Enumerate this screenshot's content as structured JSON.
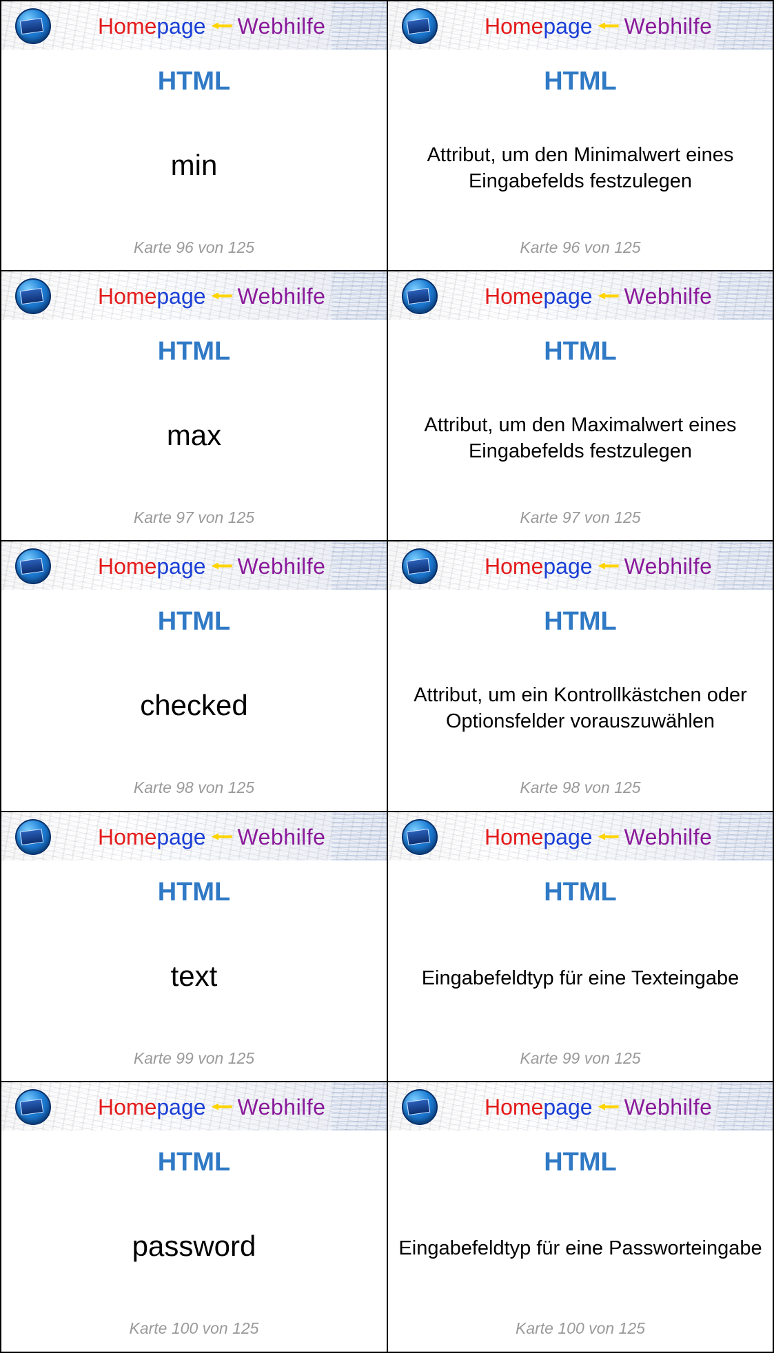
{
  "cards": [
    {
      "banner": {
        "word1": "Home",
        "word2": "page",
        "word3": "Webhilfe"
      },
      "subject": "HTML",
      "term": "min",
      "footer": "Karte 96 von 125"
    },
    {
      "banner": {
        "word1": "Home",
        "word2": "page",
        "word3": "Webhilfe"
      },
      "subject": "HTML",
      "definition": "Attribut, um den Minimalwert eines Eingabefelds festzulegen",
      "footer": "Karte 96 von 125"
    },
    {
      "banner": {
        "word1": "Home",
        "word2": "page",
        "word3": "Webhilfe"
      },
      "subject": "HTML",
      "term": "max",
      "footer": "Karte 97 von 125"
    },
    {
      "banner": {
        "word1": "Home",
        "word2": "page",
        "word3": "Webhilfe"
      },
      "subject": "HTML",
      "definition": "Attribut, um den Maximalwert eines Eingabefelds festzulegen",
      "footer": "Karte 97 von 125"
    },
    {
      "banner": {
        "word1": "Home",
        "word2": "page",
        "word3": "Webhilfe"
      },
      "subject": "HTML",
      "term": "checked",
      "footer": "Karte 98 von 125"
    },
    {
      "banner": {
        "word1": "Home",
        "word2": "page",
        "word3": "Webhilfe"
      },
      "subject": "HTML",
      "definition": "Attribut, um ein Kontrollkästchen oder Optionsfelder vorauszuwählen",
      "footer": "Karte 98 von 125"
    },
    {
      "banner": {
        "word1": "Home",
        "word2": "page",
        "word3": "Webhilfe"
      },
      "subject": "HTML",
      "term": "text",
      "footer": "Karte 99 von 125"
    },
    {
      "banner": {
        "word1": "Home",
        "word2": "page",
        "word3": "Webhilfe"
      },
      "subject": "HTML",
      "definition": "Eingabefeldtyp für eine Texteingabe",
      "footer": "Karte 99 von 125"
    },
    {
      "banner": {
        "word1": "Home",
        "word2": "page",
        "word3": "Webhilfe"
      },
      "subject": "HTML",
      "term": "password",
      "footer": "Karte 100 von 125"
    },
    {
      "banner": {
        "word1": "Home",
        "word2": "page",
        "word3": "Webhilfe"
      },
      "subject": "HTML",
      "definition": "Eingabefeldtyp für eine Passworteingabe",
      "footer": "Karte 100 von 125"
    }
  ]
}
